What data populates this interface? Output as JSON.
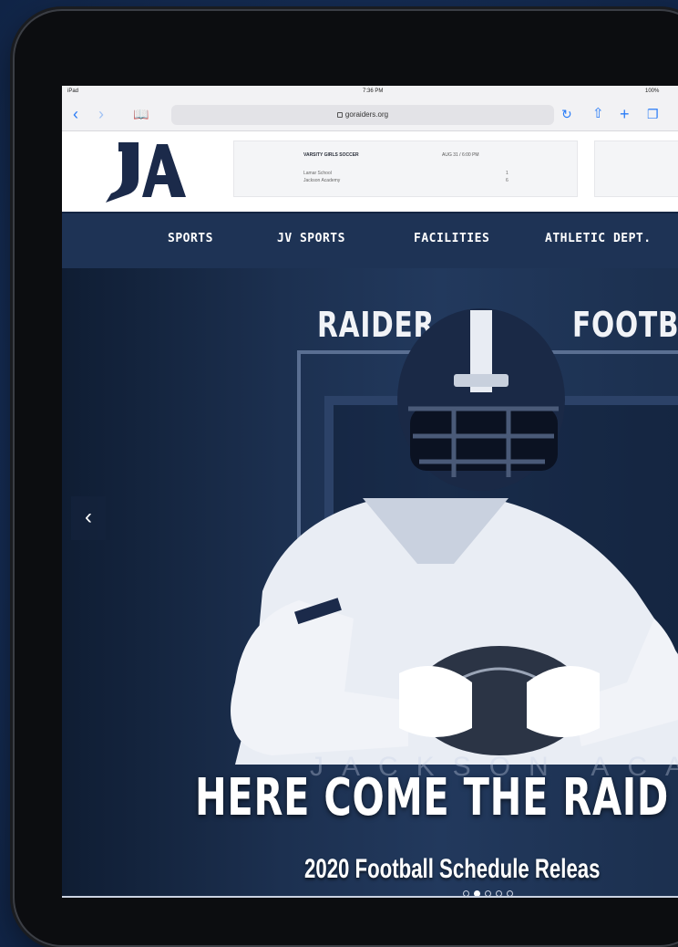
{
  "status_bar": {
    "device": "iPad",
    "time": "7:36 PM",
    "battery": "100%"
  },
  "browser": {
    "url": "goraiders.org"
  },
  "header": {
    "logo_text": "JA",
    "scoreboard": {
      "title": "VARSITY GIRLS SOCCER",
      "date": "AUG 31 / 6:00 PM",
      "teams": [
        {
          "name": "Lamar School",
          "score": "1"
        },
        {
          "name": "Jackson Academy",
          "score": "6"
        }
      ]
    }
  },
  "nav": {
    "items": [
      "SPORTS",
      "JV SPORTS",
      "FACILITIES",
      "ATHLETIC DEPT."
    ]
  },
  "hero": {
    "tag_left": "RAIDER",
    "tag_right": "FOOTBA",
    "watermark": "JACKSON ACADEM",
    "headline": "HERE COME THE RAID",
    "subline": "2020 Football Schedule Releas",
    "slides_total": 5,
    "active_slide": 2
  },
  "colors": {
    "nav_bg": "#1e3355",
    "brand_blue": "#1b2a4a",
    "page_bg": "#17305a"
  }
}
